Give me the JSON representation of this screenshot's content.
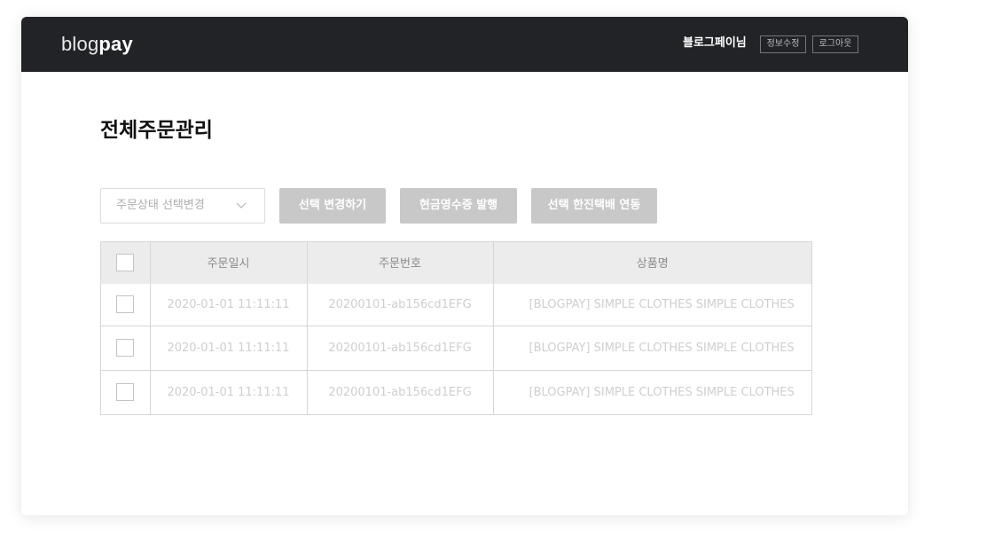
{
  "header": {
    "logo_light": "blog",
    "logo_bold": "pay",
    "user_name": "블로그페이님",
    "edit_info_label": "정보수정",
    "logout_label": "로그아웃"
  },
  "page": {
    "title": "전체주문관리"
  },
  "toolbar": {
    "status_select_placeholder": "주문상태 선택변경",
    "change_selected_label": "선택 변경하기",
    "cash_receipt_label": "현금영수증 발행",
    "hanjin_link_label": "선택 한진택배 연동"
  },
  "table": {
    "columns": [
      "주문일시",
      "주문번호",
      "상품명"
    ],
    "rows": [
      {
        "date": "2020-01-01 11:11:11",
        "order_no": "20200101-ab156cd1EFG",
        "product": "[BLOGPAY] SIMPLE CLOTHES SIMPLE CLOTHES"
      },
      {
        "date": "2020-01-01 11:11:11",
        "order_no": "20200101-ab156cd1EFG",
        "product": "[BLOGPAY] SIMPLE CLOTHES SIMPLE CLOTHES"
      },
      {
        "date": "2020-01-01 11:11:11",
        "order_no": "20200101-ab156cd1EFG",
        "product": "[BLOGPAY] SIMPLE CLOTHES SIMPLE CLOTHES"
      }
    ]
  },
  "colors": {
    "topbar": "#222327",
    "disabled_button": "#c8c8c8",
    "table_header": "#ececec"
  },
  "icons": {
    "select_arrow": "chevron-down-icon"
  }
}
